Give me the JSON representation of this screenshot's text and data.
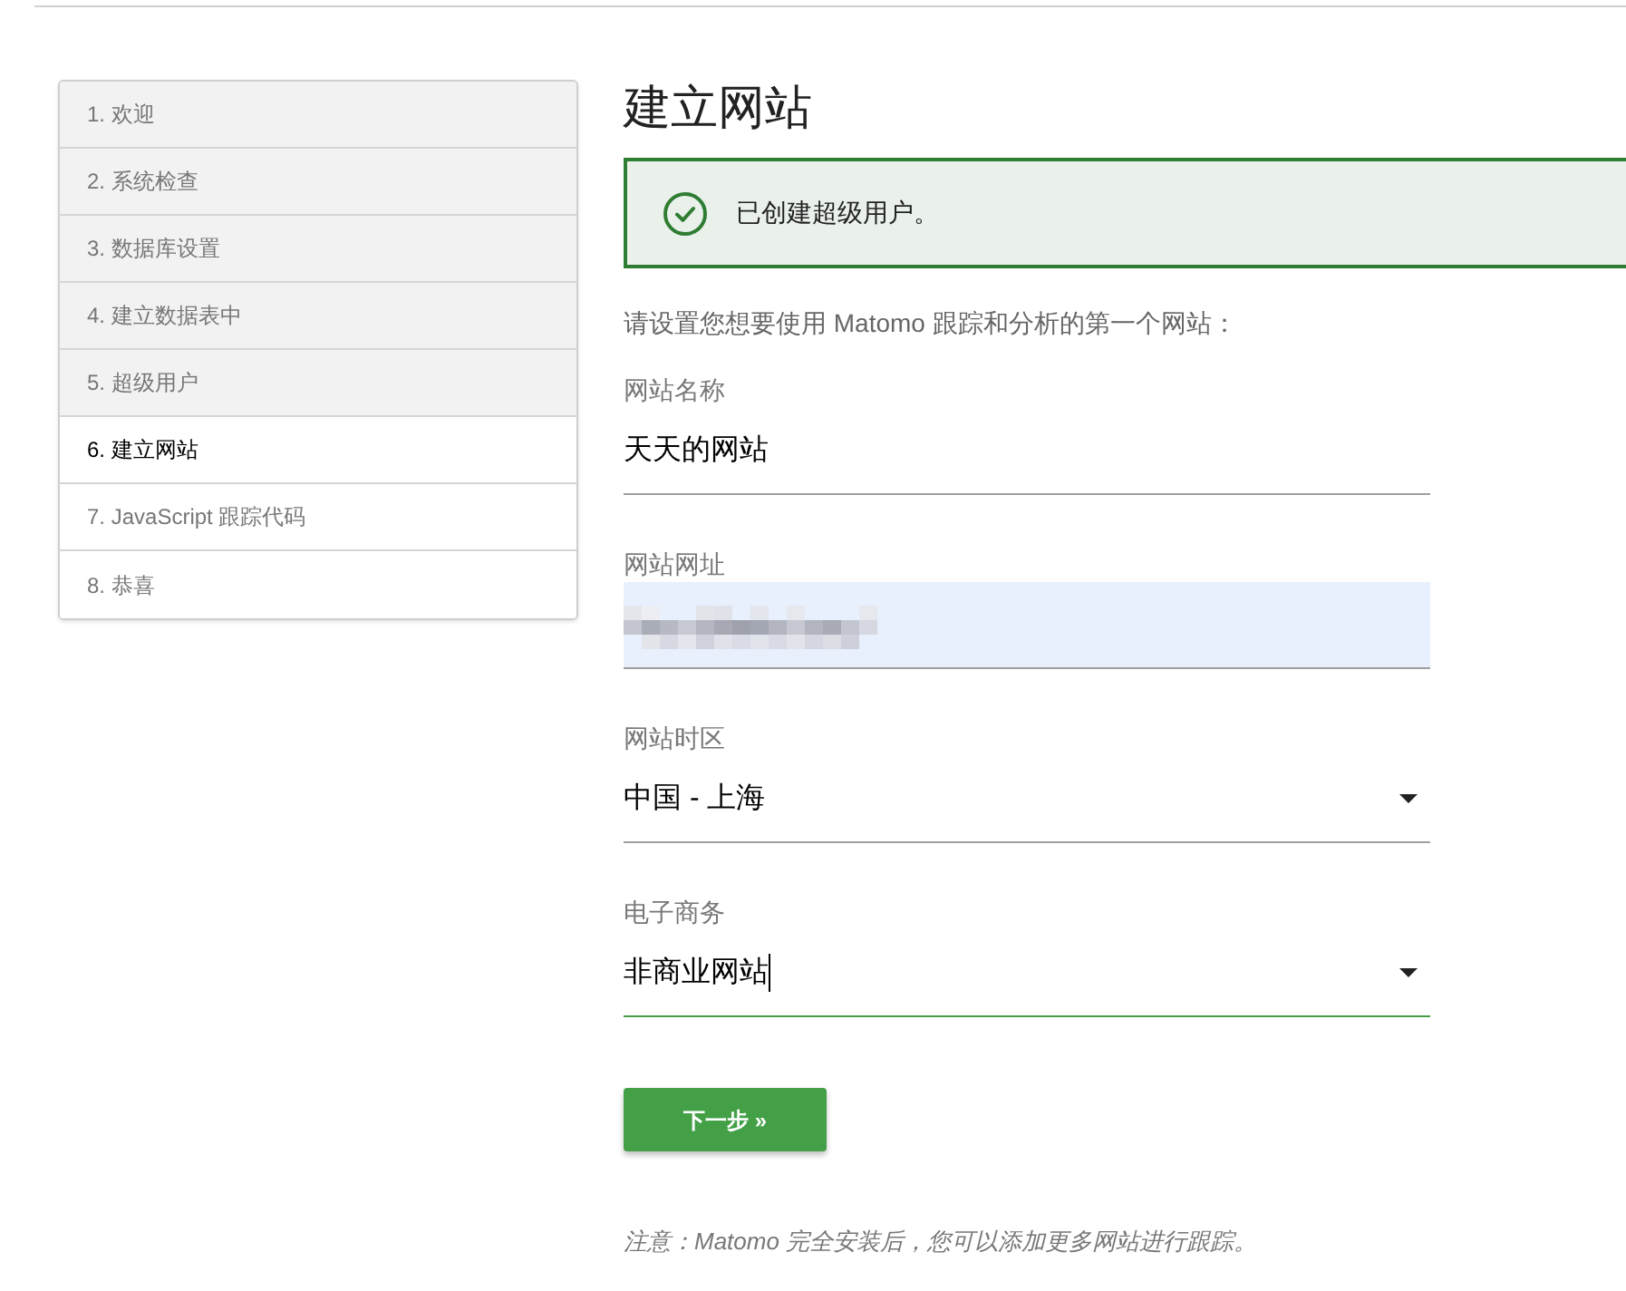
{
  "steps": [
    {
      "label": "1. 欢迎",
      "done": true,
      "selected": false
    },
    {
      "label": "2. 系统检查",
      "done": true,
      "selected": false
    },
    {
      "label": "3. 数据库设置",
      "done": true,
      "selected": false
    },
    {
      "label": "4. 建立数据表中",
      "done": true,
      "selected": false
    },
    {
      "label": "5. 超级用户",
      "done": true,
      "selected": false
    },
    {
      "label": "6. 建立网站",
      "done": false,
      "selected": true
    },
    {
      "label": "7. JavaScript 跟踪代码",
      "done": false,
      "selected": false
    },
    {
      "label": "8. 恭喜",
      "done": false,
      "selected": false
    }
  ],
  "page": {
    "title": "建立网站"
  },
  "notification": {
    "kind": "success",
    "message": "已创建超级用户。"
  },
  "intro": "请设置您想要使用 Matomo 跟踪和分析的第一个网站：",
  "fields": [
    {
      "kind": "text",
      "label": "网站名称",
      "value": "天天的网站",
      "focused": false,
      "autofilled": false
    },
    {
      "kind": "text",
      "label": "网站网址",
      "focused": false,
      "autofilled": true,
      "redacted": true
    },
    {
      "kind": "select",
      "label": "网站时区",
      "value": "中国 - 上海",
      "focused": false
    },
    {
      "kind": "select",
      "label": "电子商务",
      "value": "非商业网站",
      "focused": true
    }
  ],
  "next_button": {
    "label": "下一步 »"
  },
  "note": "注意：Matomo 完全安装后，您可以添加更多网站进行跟踪。"
}
